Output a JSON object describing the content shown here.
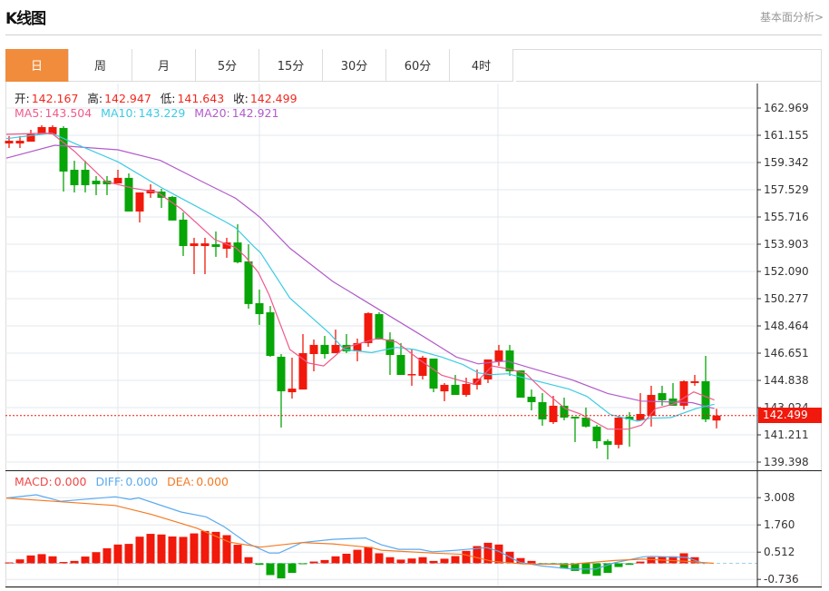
{
  "header": {
    "title": "K线图",
    "link": "基本面分析>"
  },
  "tabs": [
    {
      "label": "日",
      "active": true
    },
    {
      "label": "周",
      "active": false
    },
    {
      "label": "月",
      "active": false
    },
    {
      "label": "5分",
      "active": false
    },
    {
      "label": "15分",
      "active": false
    },
    {
      "label": "30分",
      "active": false
    },
    {
      "label": "60分",
      "active": false
    },
    {
      "label": "4时",
      "active": false
    }
  ],
  "ohlc": {
    "open_label": "开:",
    "open": "142.167",
    "high_label": "高:",
    "high": "142.947",
    "low_label": "低:",
    "low": "141.643",
    "close_label": "收:",
    "close": "142.499"
  },
  "ma": {
    "ma5_label": "MA5:",
    "ma5": "143.504",
    "ma10_label": "MA10:",
    "ma10": "143.229",
    "ma20_label": "MA20:",
    "ma20": "142.921"
  },
  "macd_legend": {
    "macd_label": "MACD:",
    "macd": "0.000",
    "diff_label": "DIFF:",
    "diff": "0.000",
    "dea_label": "DEA:",
    "dea": "0.000"
  },
  "current_price": "142.499",
  "colors": {
    "up": "#f1190b",
    "down": "#07a507",
    "ma5": "#ef5b8c",
    "ma10": "#3ccbe4",
    "ma20": "#b25bca",
    "diff": "#5aaaf0",
    "dea": "#f57a22",
    "accent": "#f08c3c"
  },
  "chart_data": [
    {
      "type": "candlestick",
      "title": "K线图 日",
      "price_ticks": [
        "162.969",
        "161.155",
        "159.342",
        "157.529",
        "155.716",
        "153.903",
        "152.090",
        "150.277",
        "148.464",
        "146.651",
        "144.838",
        "143.024",
        "141.211",
        "139.398"
      ],
      "ylim": [
        139.398,
        162.969
      ],
      "candles_ohlc": [
        [
          160.61,
          161.1,
          160.31,
          160.79
        ],
        [
          160.61,
          161.1,
          160.31,
          160.79
        ],
        [
          160.73,
          161.52,
          160.73,
          161.28
        ],
        [
          161.22,
          161.82,
          161.22,
          161.7
        ],
        [
          161.22,
          161.82,
          161.22,
          161.7
        ],
        [
          161.64,
          161.76,
          157.41,
          158.74
        ],
        [
          158.86,
          159.46,
          157.35,
          157.83
        ],
        [
          158.86,
          159.46,
          157.35,
          157.83
        ],
        [
          158.13,
          158.44,
          157.17,
          157.89
        ],
        [
          158.13,
          158.44,
          157.17,
          157.89
        ],
        [
          157.95,
          158.86,
          157.95,
          158.32
        ],
        [
          158.32,
          158.62,
          156.08,
          156.08
        ],
        [
          156.08,
          157.35,
          155.35,
          157.35
        ],
        [
          157.29,
          157.89,
          156.99,
          157.53
        ],
        [
          157.41,
          157.59,
          156.32,
          156.99
        ],
        [
          157.05,
          157.11,
          155.48,
          155.48
        ],
        [
          155.54,
          156.02,
          153.12,
          153.78
        ],
        [
          153.78,
          154.33,
          151.91,
          153.96
        ],
        [
          153.78,
          154.33,
          151.91,
          153.96
        ],
        [
          153.9,
          154.75,
          153.06,
          153.72
        ],
        [
          153.6,
          154.33,
          153.0,
          154.02
        ],
        [
          154.02,
          155.23,
          152.63,
          152.7
        ],
        [
          152.76,
          153.9,
          149.61,
          149.92
        ],
        [
          149.98,
          150.88,
          148.53,
          149.25
        ],
        [
          149.37,
          149.79,
          146.41,
          146.47
        ],
        [
          146.41,
          146.59,
          141.7,
          144.11
        ],
        [
          144.05,
          146.35,
          143.63,
          144.29
        ],
        [
          144.23,
          147.92,
          144.23,
          146.65
        ],
        [
          146.59,
          147.56,
          145.44,
          147.2
        ],
        [
          147.2,
          147.8,
          146.29,
          146.59
        ],
        [
          146.65,
          148.22,
          146.65,
          147.2
        ],
        [
          147.2,
          147.92,
          146.65,
          146.77
        ],
        [
          146.77,
          147.62,
          146.11,
          147.32
        ],
        [
          147.32,
          149.37,
          147.07,
          149.31
        ],
        [
          149.25,
          149.37,
          147.56,
          147.56
        ],
        [
          147.56,
          148.04,
          145.2,
          146.53
        ],
        [
          146.53,
          147.32,
          145.2,
          145.2
        ],
        [
          145.2,
          146.89,
          144.48,
          145.26
        ],
        [
          145.14,
          146.47,
          144.9,
          146.35
        ],
        [
          146.29,
          146.29,
          144.05,
          144.29
        ],
        [
          144.11,
          144.66,
          143.45,
          144.54
        ],
        [
          144.54,
          145.2,
          143.87,
          143.87
        ],
        [
          143.87,
          145.02,
          143.75,
          144.6
        ],
        [
          144.54,
          145.56,
          144.23,
          144.96
        ],
        [
          144.9,
          146.23,
          144.66,
          146.23
        ],
        [
          146.11,
          147.2,
          145.81,
          146.83
        ],
        [
          146.83,
          147.2,
          145.14,
          145.44
        ],
        [
          145.5,
          145.5,
          143.69,
          143.69
        ],
        [
          143.75,
          144.23,
          142.84,
          143.39
        ],
        [
          143.39,
          143.99,
          141.82,
          142.24
        ],
        [
          142.06,
          143.81,
          141.94,
          143.15
        ],
        [
          143.15,
          143.69,
          142.18,
          142.36
        ],
        [
          142.42,
          142.42,
          140.73,
          142.3
        ],
        [
          142.36,
          143.03,
          141.7,
          141.76
        ],
        [
          141.76,
          141.88,
          140.31,
          140.79
        ],
        [
          140.79,
          140.91,
          139.58,
          140.55
        ],
        [
          140.55,
          142.48,
          140.31,
          142.36
        ],
        [
          142.42,
          142.72,
          140.43,
          142.24
        ],
        [
          142.18,
          143.99,
          142.18,
          142.6
        ],
        [
          142.48,
          144.48,
          141.76,
          143.87
        ],
        [
          143.99,
          144.48,
          143.15,
          143.51
        ],
        [
          143.63,
          144.66,
          143.15,
          143.15
        ],
        [
          143.15,
          144.84,
          142.9,
          144.78
        ],
        [
          144.66,
          145.2,
          144.48,
          144.78
        ],
        [
          144.78,
          146.47,
          142.06,
          142.24
        ],
        [
          142.167,
          142.947,
          141.643,
          142.499
        ]
      ],
      "ma5": [
        [
          -0.25,
          161.22
        ],
        [
          3.9,
          161.3
        ],
        [
          6,
          160.09
        ],
        [
          8.9,
          158.07
        ],
        [
          11.4,
          157.63
        ],
        [
          13.6,
          157.37
        ],
        [
          15.8,
          156.26
        ],
        [
          18.9,
          154.21
        ],
        [
          20.8,
          153.68
        ],
        [
          21.7,
          153.08
        ],
        [
          22.9,
          152.03
        ],
        [
          23.9,
          150.52
        ],
        [
          25.8,
          146.89
        ],
        [
          27.5,
          145.99
        ],
        [
          28.9,
          145.8
        ],
        [
          30.8,
          147.01
        ],
        [
          33.9,
          147.64
        ],
        [
          35.6,
          147.39
        ],
        [
          37.75,
          146.19
        ],
        [
          39.75,
          145.18
        ],
        [
          41.7,
          144.78
        ],
        [
          42.75,
          144.58
        ],
        [
          44.4,
          145.8
        ],
        [
          45.8,
          145.62
        ],
        [
          47.5,
          145.28
        ],
        [
          48.9,
          144.28
        ],
        [
          51.1,
          142.96
        ],
        [
          52.5,
          142.6
        ],
        [
          55,
          141.59
        ],
        [
          56.9,
          141.59
        ],
        [
          58.1,
          141.86
        ],
        [
          59.4,
          142.96
        ],
        [
          61.1,
          143.27
        ],
        [
          62.9,
          144.07
        ],
        [
          64.8,
          143.53
        ]
      ],
      "ma10": [
        [
          -0.25,
          160.93
        ],
        [
          3.9,
          161.3
        ],
        [
          6.1,
          160.59
        ],
        [
          10,
          159.39
        ],
        [
          13.9,
          157.71
        ],
        [
          15.8,
          156.97
        ],
        [
          20,
          155.35
        ],
        [
          20.8,
          155.01
        ],
        [
          22.5,
          153.74
        ],
        [
          23.1,
          153.34
        ],
        [
          25.8,
          150.32
        ],
        [
          29.4,
          148.0
        ],
        [
          30.8,
          146.89
        ],
        [
          33.3,
          146.69
        ],
        [
          35.6,
          147.03
        ],
        [
          37.25,
          146.89
        ],
        [
          39.75,
          146.39
        ],
        [
          41.7,
          145.89
        ],
        [
          43.1,
          145.34
        ],
        [
          44.2,
          145.22
        ],
        [
          45.8,
          145.28
        ],
        [
          49.2,
          144.67
        ],
        [
          51.4,
          144.27
        ],
        [
          53.1,
          143.77
        ],
        [
          55.25,
          142.56
        ],
        [
          57.75,
          142.12
        ],
        [
          58.9,
          142.32
        ],
        [
          60.8,
          142.36
        ],
        [
          63.1,
          142.96
        ],
        [
          64.8,
          143.25
        ]
      ],
      "ma20": [
        [
          -0.25,
          159.63
        ],
        [
          4.2,
          160.49
        ],
        [
          10,
          160.19
        ],
        [
          13.9,
          159.48
        ],
        [
          17.75,
          158.07
        ],
        [
          20.8,
          156.97
        ],
        [
          22.5,
          156.02
        ],
        [
          23.1,
          155.66
        ],
        [
          25.8,
          153.64
        ],
        [
          29.75,
          151.42
        ],
        [
          32.25,
          150.32
        ],
        [
          35,
          149.11
        ],
        [
          37.75,
          147.9
        ],
        [
          41.1,
          146.39
        ],
        [
          43.1,
          145.94
        ],
        [
          45,
          146.09
        ],
        [
          44.2,
          146.03
        ],
        [
          45.8,
          146.12
        ],
        [
          48.3,
          145.58
        ],
        [
          51.7,
          144.88
        ],
        [
          55,
          143.97
        ],
        [
          58.1,
          143.46
        ],
        [
          62.75,
          143.36
        ],
        [
          64.8,
          142.96
        ]
      ]
    },
    {
      "type": "bar+line",
      "title": "MACD",
      "ticks": [
        "3.008",
        "1.760",
        "0.512",
        "-0.736"
      ],
      "ylim": [
        -0.736,
        3.008
      ],
      "histogram": [
        0.04,
        0.18,
        0.36,
        0.42,
        0.32,
        0.06,
        0.11,
        0.31,
        0.51,
        0.69,
        0.86,
        0.89,
        1.22,
        1.35,
        1.32,
        1.23,
        1.21,
        1.37,
        1.48,
        1.44,
        1.29,
        0.85,
        0.28,
        -0.07,
        -0.54,
        -0.69,
        -0.44,
        -0.04,
        0.08,
        0.15,
        0.32,
        0.44,
        0.62,
        0.75,
        0.46,
        0.28,
        0.17,
        0.22,
        0.28,
        0.11,
        0.21,
        0.33,
        0.57,
        0.79,
        0.94,
        0.86,
        0.53,
        0.24,
        0.11,
        -0.06,
        -0.06,
        -0.24,
        -0.35,
        -0.49,
        -0.57,
        -0.44,
        -0.17,
        -0.07,
        0.08,
        0.28,
        0.31,
        0.32,
        0.46,
        0.28
      ],
      "diff": [
        [
          -0.25,
          2.99
        ],
        [
          2.5,
          3.14
        ],
        [
          4.75,
          2.84
        ],
        [
          9.75,
          3.05
        ],
        [
          11.1,
          2.93
        ],
        [
          11.9,
          3.0
        ],
        [
          15.8,
          2.35
        ],
        [
          18.1,
          2.13
        ],
        [
          19.75,
          1.68
        ],
        [
          21.9,
          0.92
        ],
        [
          23.9,
          0.47
        ],
        [
          24.8,
          0.47
        ],
        [
          26.9,
          0.95
        ],
        [
          29.75,
          1.1
        ],
        [
          32.75,
          1.16
        ],
        [
          34.2,
          0.85
        ],
        [
          35.8,
          0.64
        ],
        [
          37.75,
          0.64
        ],
        [
          38.9,
          0.53
        ],
        [
          41.1,
          0.6
        ],
        [
          43.9,
          0.72
        ],
        [
          45,
          0.55
        ],
        [
          46.9,
          0.05
        ],
        [
          48.9,
          -0.12
        ],
        [
          51.7,
          -0.26
        ],
        [
          53.9,
          -0.26
        ],
        [
          55.6,
          0.02
        ],
        [
          58.3,
          0.3
        ],
        [
          59,
          0.32
        ],
        [
          62.25,
          0.27
        ],
        [
          63.9,
          -0.02
        ]
      ],
      "dea": [
        [
          -0.25,
          2.99
        ],
        [
          4.75,
          2.82
        ],
        [
          9.75,
          2.65
        ],
        [
          13.1,
          2.24
        ],
        [
          17.25,
          1.61
        ],
        [
          20.25,
          0.97
        ],
        [
          23.1,
          0.74
        ],
        [
          26.9,
          0.95
        ],
        [
          29.75,
          0.89
        ],
        [
          34.2,
          0.6
        ],
        [
          33.3,
          0.72
        ],
        [
          38.9,
          0.47
        ],
        [
          41.7,
          0.41
        ],
        [
          44.4,
          0.09
        ],
        [
          47.25,
          -0.03
        ],
        [
          51.4,
          -0.05
        ],
        [
          55.6,
          0.13
        ],
        [
          58.3,
          0.19
        ],
        [
          62.25,
          0.09
        ],
        [
          64.75,
          0.0
        ]
      ]
    }
  ]
}
